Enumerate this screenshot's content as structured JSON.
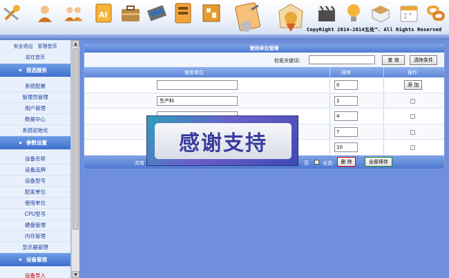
{
  "header": {
    "copyright": "CopyRight 2014-2014五处™. All Rights Reserved",
    "icons": [
      "tools-icon",
      "user-icon",
      "users-icon",
      "ai-document-icon",
      "briefcase-icon",
      "memory-chip-icon",
      "hard-drive-icon",
      "circuit-board-icon",
      "document-pen-icon",
      "award-badge-icon",
      "clapperboard-icon",
      "lightbulb-icon",
      "books-icon",
      "calendar-icon",
      "link-icon"
    ]
  },
  "sidebar": {
    "top_links": [
      "安全退出",
      "管理首页"
    ],
    "home_link": "前往首页",
    "sections": [
      {
        "title": "首选服务",
        "items": [
          "系统配置",
          "管理员管理",
          "用户管理",
          "数据中心",
          "系统初始化"
        ]
      },
      {
        "title": "参数设置",
        "items": [
          "设备名称",
          "设备品牌",
          "设备型号",
          "配发单位",
          "使用单位",
          "CPU型号",
          "硬盘管理",
          "内存管理",
          "显示器管理"
        ]
      },
      {
        "title": "设备管理",
        "items": [
          "设备导入"
        ]
      }
    ]
  },
  "panel": {
    "title": "使用单位管理",
    "search_label": "检索关键词：",
    "search_value": "",
    "query_button": "查 询",
    "clear_button": "清除条件",
    "columns": [
      "使用单位",
      "排序",
      "操作"
    ],
    "add_button": "添 加",
    "rows": [
      {
        "name": "",
        "order": "0"
      },
      {
        "name": "生产科",
        "order": "1"
      },
      {
        "name": "",
        "order": "4"
      },
      {
        "name": "",
        "order": "7"
      },
      {
        "name": "",
        "order": "10"
      }
    ],
    "footer_prefix": "共有",
    "footer_page": "页",
    "select_all_label": "全选:",
    "delete_button": "删 除",
    "save_all_button": "全部保存"
  },
  "overlay": {
    "text": "感谢支持"
  }
}
